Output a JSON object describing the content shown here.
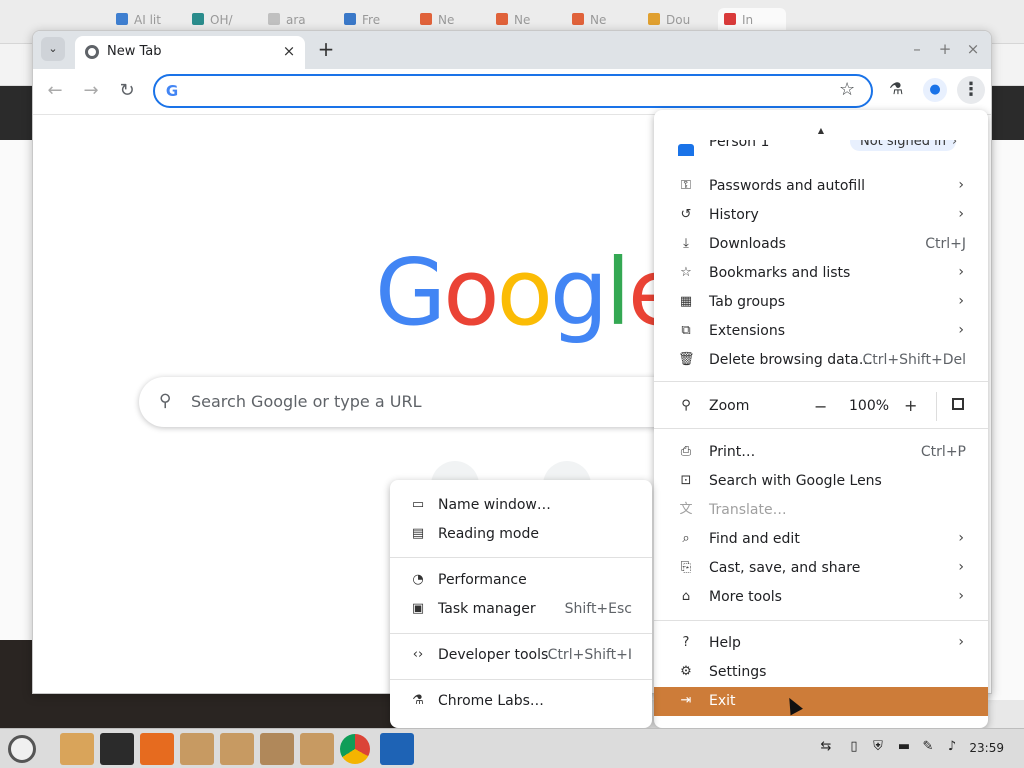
{
  "background_window": {
    "tabs": [
      {
        "label": "AI lit"
      },
      {
        "label": "OH/"
      },
      {
        "label": "ara"
      },
      {
        "label": "Fre"
      },
      {
        "label": "Ne"
      },
      {
        "label": "Ne"
      },
      {
        "label": "Ne"
      },
      {
        "label": "Dou"
      },
      {
        "label": "In"
      }
    ]
  },
  "window": {
    "tab_title": "New Tab",
    "tab_close": "×",
    "new_tab": "+",
    "controls": {
      "minimize": "–",
      "maximize": "+",
      "close": "×"
    }
  },
  "toolbar": {
    "back": "←",
    "forward": "→",
    "reload": "↻",
    "omnibox_value": "",
    "omnibox_g": "G",
    "star": "☆",
    "labs": "⚗",
    "profile": "●",
    "menu": "⋮"
  },
  "ntp": {
    "logo_letters": [
      {
        "ch": "G",
        "color": "#4285f4"
      },
      {
        "ch": "o",
        "color": "#ea4335"
      },
      {
        "ch": "o",
        "color": "#fbbc05"
      },
      {
        "ch": "g",
        "color": "#4285f4"
      },
      {
        "ch": "l",
        "color": "#34a853"
      },
      {
        "ch": "e",
        "color": "#ea4335"
      }
    ],
    "search_placeholder": "Search Google or type a URL"
  },
  "main_menu": {
    "profile": {
      "name": "Person 1",
      "status": "Not signed in"
    },
    "items": [
      {
        "label": "Passwords and autofill",
        "icon": "key-icon",
        "glyph": "⚿",
        "arrow": "›"
      },
      {
        "label": "History",
        "icon": "history-icon",
        "glyph": "↺",
        "arrow": "›"
      },
      {
        "label": "Downloads",
        "icon": "download-icon",
        "glyph": "⤓",
        "shortcut": "Ctrl+J"
      },
      {
        "label": "Bookmarks and lists",
        "icon": "star-icon",
        "glyph": "☆",
        "arrow": "›"
      },
      {
        "label": "Tab groups",
        "icon": "grid-icon",
        "glyph": "▦",
        "arrow": "›"
      },
      {
        "label": "Extensions",
        "icon": "puzzle-icon",
        "glyph": "⧉",
        "arrow": "›"
      },
      {
        "label": "Delete browsing data…",
        "icon": "trash-icon",
        "glyph": "🗑",
        "shortcut": "Ctrl+Shift+Del"
      }
    ],
    "zoom": {
      "label": "Zoom",
      "minus": "−",
      "value": "100%",
      "plus": "+"
    },
    "items2": [
      {
        "label": "Print…",
        "icon": "print-icon",
        "glyph": "⎙",
        "shortcut": "Ctrl+P"
      },
      {
        "label": "Search with Google Lens",
        "icon": "lens-icon",
        "glyph": "⊡"
      },
      {
        "label": "Translate…",
        "icon": "translate-icon",
        "glyph": "文",
        "disabled": true
      },
      {
        "label": "Find and edit",
        "icon": "find-icon",
        "glyph": "⌕",
        "arrow": "›"
      },
      {
        "label": "Cast, save, and share",
        "icon": "cast-icon",
        "glyph": "⎘",
        "arrow": "›"
      },
      {
        "label": "More tools",
        "icon": "toolbox-icon",
        "glyph": "⌂",
        "arrow": "›"
      }
    ],
    "items3": [
      {
        "label": "Help",
        "icon": "help-icon",
        "glyph": "?",
        "arrow": "›"
      },
      {
        "label": "Settings",
        "icon": "gear-icon",
        "glyph": "⚙"
      },
      {
        "label": "Exit",
        "icon": "exit-icon",
        "glyph": "⇥",
        "highlighted": true
      }
    ]
  },
  "sub_menu": {
    "items": [
      {
        "label": "Name window…",
        "icon": "window-icon",
        "glyph": "▭"
      },
      {
        "label": "Reading mode",
        "icon": "reading-icon",
        "glyph": "▤"
      }
    ],
    "items2": [
      {
        "label": "Performance",
        "icon": "gauge-icon",
        "glyph": "◔"
      },
      {
        "label": "Task manager",
        "icon": "task-icon",
        "glyph": "▣",
        "shortcut": "Shift+Esc"
      }
    ],
    "items3": [
      {
        "label": "Developer tools",
        "icon": "code-icon",
        "glyph": "‹›",
        "shortcut": "Ctrl+Shift+I"
      }
    ],
    "items4": [
      {
        "label": "Chrome Labs…",
        "icon": "labs-icon",
        "glyph": "⚗"
      }
    ]
  },
  "taskbar": {
    "clock": "23:59",
    "apps": [
      {
        "name": "folder-app",
        "color": "#d9a45a"
      },
      {
        "name": "terminal-app",
        "color": "#2b2b2b"
      },
      {
        "name": "firefox-app",
        "color": "#e66b1f"
      },
      {
        "name": "package-app-1",
        "color": "#c79a62"
      },
      {
        "name": "package-app-2",
        "color": "#c79a62"
      },
      {
        "name": "package-app-3",
        "color": "#b0885a"
      },
      {
        "name": "package-app-4",
        "color": "#c79a62"
      },
      {
        "name": "chrome-app",
        "color": "#db4437"
      },
      {
        "name": "transfer-app",
        "color": "#1e63b5"
      }
    ]
  }
}
